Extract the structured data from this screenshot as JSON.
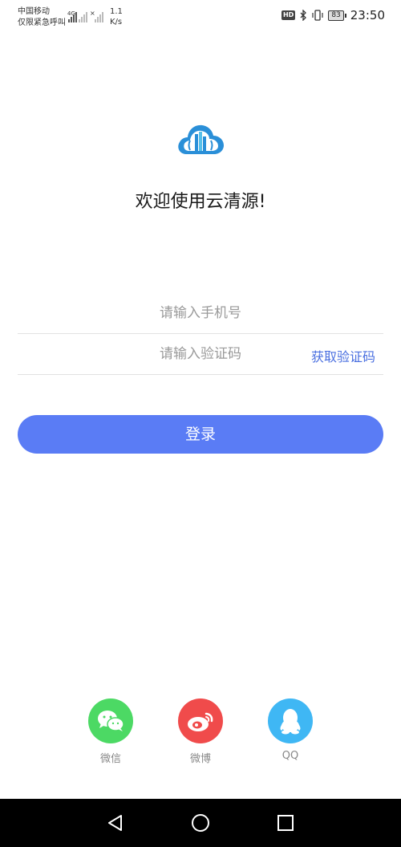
{
  "status_bar": {
    "carrier_name": "中国移动",
    "carrier_status": "仅限紧急呼叫",
    "network_type": "4G",
    "speed_value": "1.1",
    "speed_unit": "K/s",
    "hd_label": "HD",
    "battery_level": "83",
    "time": "23:50"
  },
  "welcome_text": "欢迎使用云清源!",
  "phone_input": {
    "placeholder": "请输入手机号",
    "value": ""
  },
  "code_input": {
    "placeholder": "请输入验证码",
    "value": ""
  },
  "get_code_label": "获取验证码",
  "login_label": "登录",
  "social": {
    "wechat_label": "微信",
    "weibo_label": "微博",
    "qq_label": "QQ"
  },
  "colors": {
    "accent": "#5a7cf5",
    "link": "#4a6fe0",
    "wechat": "#4cd964",
    "weibo": "#f04b4b",
    "qq": "#3fb7f4"
  },
  "icons": {
    "logo": "cloud-city-logo-icon",
    "bluetooth": "bluetooth-icon",
    "vibrate": "vibrate-icon",
    "back": "back-triangle-icon",
    "home": "home-circle-icon",
    "recent": "recent-square-icon"
  }
}
